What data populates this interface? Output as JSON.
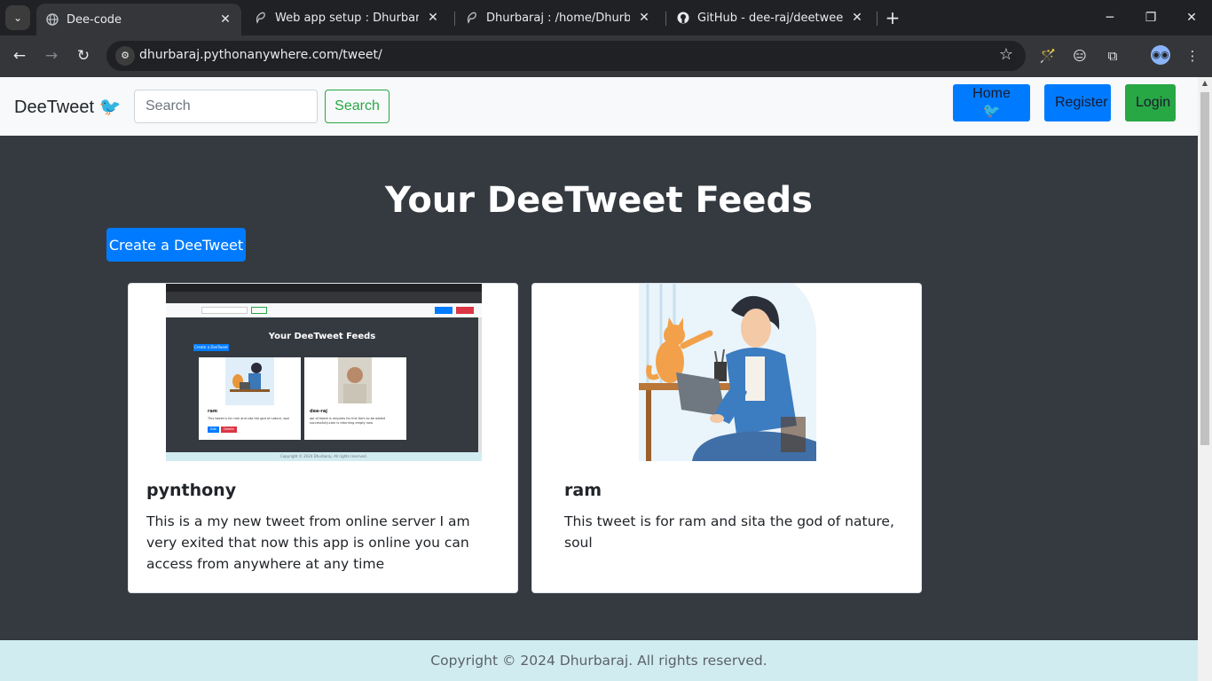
{
  "browser": {
    "tabs": [
      {
        "title": "Dee-code",
        "active": true
      },
      {
        "title": "Web app setup : Dhurbaraj : Pyt",
        "active": false
      },
      {
        "title": "Dhurbaraj : /home/Dhurbaraj : I",
        "active": false
      },
      {
        "title": "GitHub - dee-raj/deetweet: Dee",
        "active": false
      }
    ],
    "url": "dhurbaraj.pythonanywhere.com/tweet/"
  },
  "navbar": {
    "brand": "DeeTweet",
    "search_placeholder": "Search",
    "search_button": "Search",
    "home_button": "Home 🐦",
    "register_button": "Register",
    "login_button": "Login"
  },
  "main": {
    "title": "Your DeeTweet Feeds",
    "create_button": "Create a DeeTweet",
    "tweets": [
      {
        "user": "pynthony",
        "text": "This is a my new tweet from online server I am very exited that now this app is online you can access from anywhere at any time"
      },
      {
        "user": "ram",
        "text": "This tweet is for ram and sita the god of nature, soul"
      }
    ]
  },
  "footer": {
    "text": "Copyright © 2024 Dhurbaraj. All rights reserved."
  },
  "mini_screenshot": {
    "title": "Your DeeTweet Feeds",
    "create_button": "Create a DeeTweet",
    "card1_user": "ram",
    "card1_text": "This tweet is for ram and sita the god of nature, soul",
    "card2_user": "dee-raj",
    "card2_text": "api of tweet is requires for this form to be added successfully.com is returning empty now",
    "edit": "Edit",
    "delete": "Delete",
    "footer": "Copyright © 2024 Dhurbaraj. All rights reserved."
  },
  "colors": {
    "primary": "#007bff",
    "success": "#28a745",
    "page_bg": "#343a40",
    "footer_bg": "#d1ecf1"
  }
}
